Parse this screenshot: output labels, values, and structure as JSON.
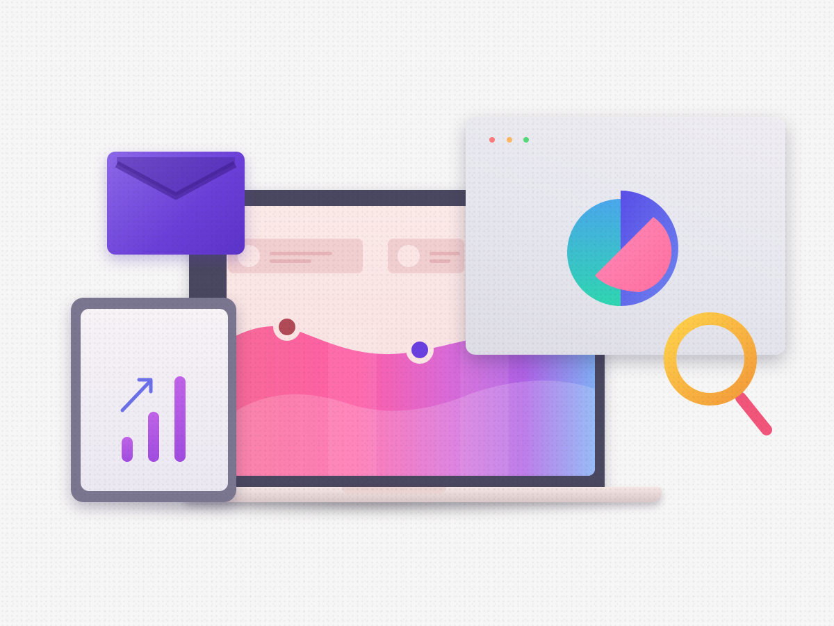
{
  "scene": {
    "background": "#f7f6f6",
    "illustration": "analytics-dashboard"
  },
  "laptop": {
    "frame_color": "#4a4760",
    "screen_color": "#fbe9e8",
    "chart_colors": [
      "#f7789c",
      "#ff5fa6",
      "#d96ad8",
      "#b062e6",
      "#8a7df0",
      "#7fb0f5"
    ]
  },
  "browser_window": {
    "traffic_lights": [
      "#ff7a7a",
      "#ffb766",
      "#57d97a"
    ],
    "pie_colors": [
      "#5a4ee8",
      "#45c4e8",
      "#ff78ad"
    ]
  },
  "icons": {
    "mail": "envelope-icon",
    "search": "magnifier-icon",
    "trend": "arrow-up-right-icon",
    "pie": "pie-chart-icon"
  },
  "colors": {
    "mail": "#6a3fd8",
    "magnifier": "#f6b93b",
    "magnifier_handle": "#f2557a",
    "accent_purple": "#6a3fd8"
  }
}
